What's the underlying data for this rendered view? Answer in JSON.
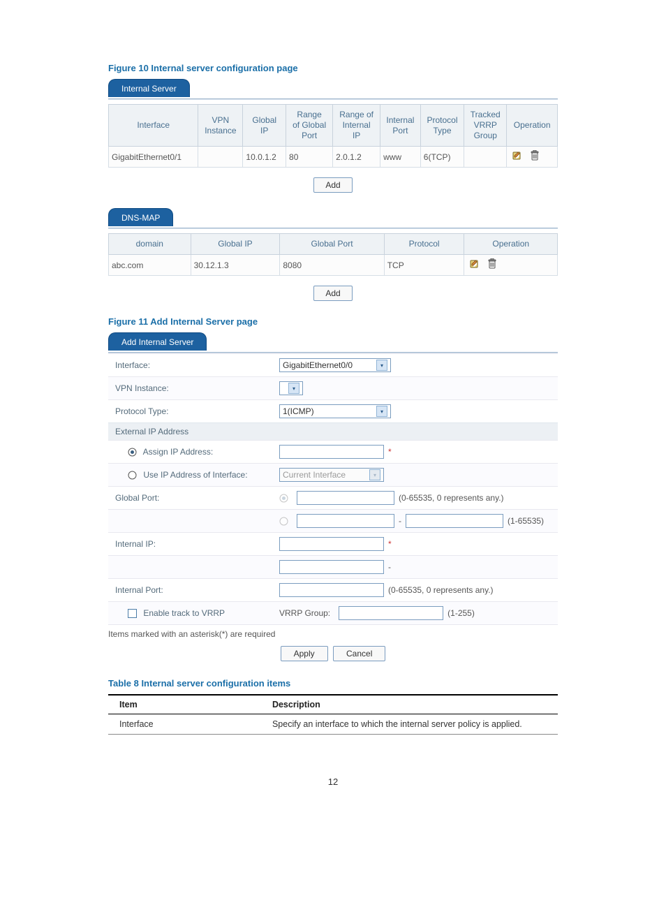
{
  "fig10": "Figure 10 Internal server configuration page",
  "tab1": "Internal Server",
  "table1": {
    "headers": [
      "Interface",
      "VPN\nInstance",
      "Global\nIP",
      "Range\nof Global\nPort",
      "Range of\nInternal\nIP",
      "Internal\nPort",
      "Protocol\nType",
      "Tracked\nVRRP\nGroup",
      "Operation"
    ],
    "rows": [
      {
        "interface": "GigabitEthernet0/1",
        "vpn": "",
        "gip": "10.0.1.2",
        "rgport": "80",
        "riip": "2.0.1.2",
        "iport": "www",
        "proto": "6(TCP)",
        "vrrp": ""
      }
    ]
  },
  "add": "Add",
  "tab2": "DNS-MAP",
  "table2": {
    "headers": [
      "domain",
      "Global IP",
      "Global Port",
      "Protocol",
      "Operation"
    ],
    "rows": [
      {
        "domain": "abc.com",
        "gip": "30.12.1.3",
        "gport": "8080",
        "proto": "TCP"
      }
    ]
  },
  "fig11": "Figure 11 Add Internal Server page",
  "tab3": "Add Internal Server",
  "form": {
    "interface_label": "Interface:",
    "interface_value": "GigabitEthernet0/0",
    "vpn_label": "VPN Instance:",
    "proto_label": "Protocol Type:",
    "proto_value": "1(ICMP)",
    "extip_head": "External IP Address",
    "assign_label": "Assign IP Address:",
    "useif_label": "Use IP Address of Interface:",
    "useif_value": "Current Interface",
    "gport_label": "Global Port:",
    "gport_hint1": "(0-65535, 0 represents any.)",
    "gport_hint2": "(1-65535)",
    "iip_label": "Internal IP:",
    "iport_label": "Internal Port:",
    "iport_hint": "(0-65535, 0 represents any.)",
    "vrrp_enable": "Enable track to VRRP",
    "vrrp_group": "VRRP Group:",
    "vrrp_hint": "(1-255)",
    "note": "Items marked with an asterisk(*) are required",
    "apply": "Apply",
    "cancel": "Cancel"
  },
  "table8caption": "Table 8 Internal server configuration items",
  "table8": {
    "headers": [
      "Item",
      "Description"
    ],
    "rows": [
      {
        "item": "Interface",
        "desc": "Specify an interface to which the internal server policy is applied."
      }
    ]
  },
  "pagenum": "12",
  "star": "*"
}
